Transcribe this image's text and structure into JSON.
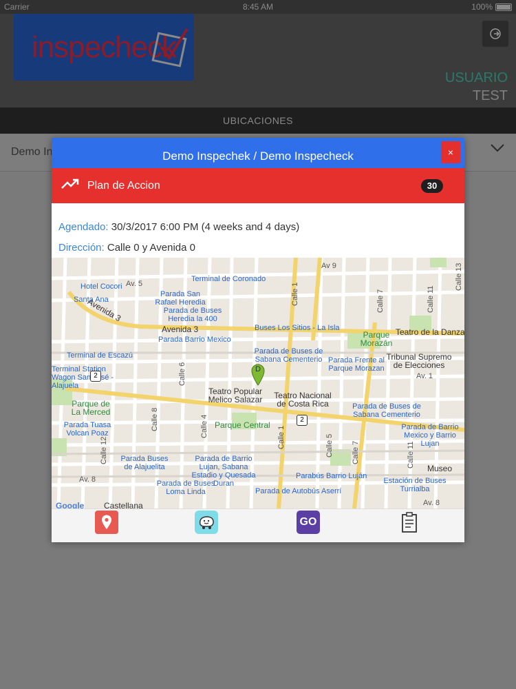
{
  "status_bar": {
    "carrier": "Carrier",
    "time": "8:45 AM",
    "battery": "100%"
  },
  "header": {
    "logo_text": "inspecheck",
    "user_label": "USUARIO",
    "user_name": "TEST"
  },
  "tabbar": {
    "title": "UBICACIONES"
  },
  "selector": {
    "value": "Demo In"
  },
  "modal": {
    "title": "Demo Inspechek / Demo Inspecheck",
    "close_label": "×",
    "plan": {
      "label": "Plan de Accion",
      "count": "30"
    },
    "scheduled_label": "Agendado:",
    "scheduled_value": "30/3/2017 6:00 PM (4 weeks and 4 days)",
    "address_label": "Dirección:",
    "address_value": "Calle 0 y Avenida 0",
    "map": {
      "marker_letter": "D",
      "labels": {
        "av9": "Av 9",
        "av5": "Av. 5",
        "hotel": "Hotel Cocori",
        "santa_ana": "Santa Ana",
        "terminal_coronado": "Terminal de Coronado",
        "parada_san_rafael": "Parada San Rafael Heredia",
        "parada_heredia_400": "Parada de Buses Heredia la 400",
        "avenida3a": "Avenida 3",
        "avenida3b": "Avenida 3",
        "parada_barrio_mexico": "Parada Barrio Mexico",
        "buses_sitios": "Buses Los Sitios - La Isla",
        "parque_morazan": "Parque Morazán",
        "teatro_danza": "Teatro de la Danza",
        "terminal_escazu": "Terminal de Escazú",
        "station_wagon": "Terminal Station Wagon San José - Alajuela",
        "parada_sabana": "Parada de Buses de Sabana Cementerio",
        "parada_frente_morazan": "Parada Frente al Parque Morazan",
        "tribunal": "Tribunal Supremo de Elecciones",
        "av1": "Av. 1",
        "teatro_popular": "Teatro Popular Melico Salazar",
        "teatro_nacional": "Teatro Nacional de Costa Rica",
        "parque_merced": "Parque de La Merced",
        "parada_sabana2": "Parada de Buses de Sabana Cementerio",
        "parque_central": "Parque Central",
        "parada_tuasa": "Parada Tuasa Volcan Poaz",
        "parada_barrio_mexico2": "Parada de Barrio Mexico y Barrio Lujan",
        "parada_alajuelita": "Parada Buses de Alajuelita",
        "parada_lujan": "Parada de Barrio Lujan, Sabana Estadio y Quesada Duran",
        "parabus_lujan": "Parabús Barrio Luján",
        "museo": "Museo",
        "av8": "Av. 8",
        "parada_loma": "Parada de Buses Loma Linda",
        "parada_asseri": "Parada de Autobús Aserrí",
        "estacion_turrialba": "Estación de Buses Turrialba",
        "castellana": "Castellana",
        "av8b": "Av. 8",
        "google": "Google",
        "calle1": "Calle 1",
        "calle7": "Calle 7",
        "calle11": "Calle 11",
        "calle13": "Calle 13",
        "calle6": "Calle 6",
        "calle8": "Calle 8",
        "calle4": "Calle 4",
        "calle12": "Calle 12",
        "calle1b": "Calle 1",
        "calle5": "Calle 5",
        "calle7b": "Calle 7",
        "calle11b": "Calle 11",
        "shield2": "2",
        "shield2b": "2"
      }
    },
    "actions": {
      "maps_icon": "map-pin-icon",
      "waze_icon": "waze-icon",
      "go_label": "GO",
      "report_icon": "clipboard-icon"
    }
  }
}
